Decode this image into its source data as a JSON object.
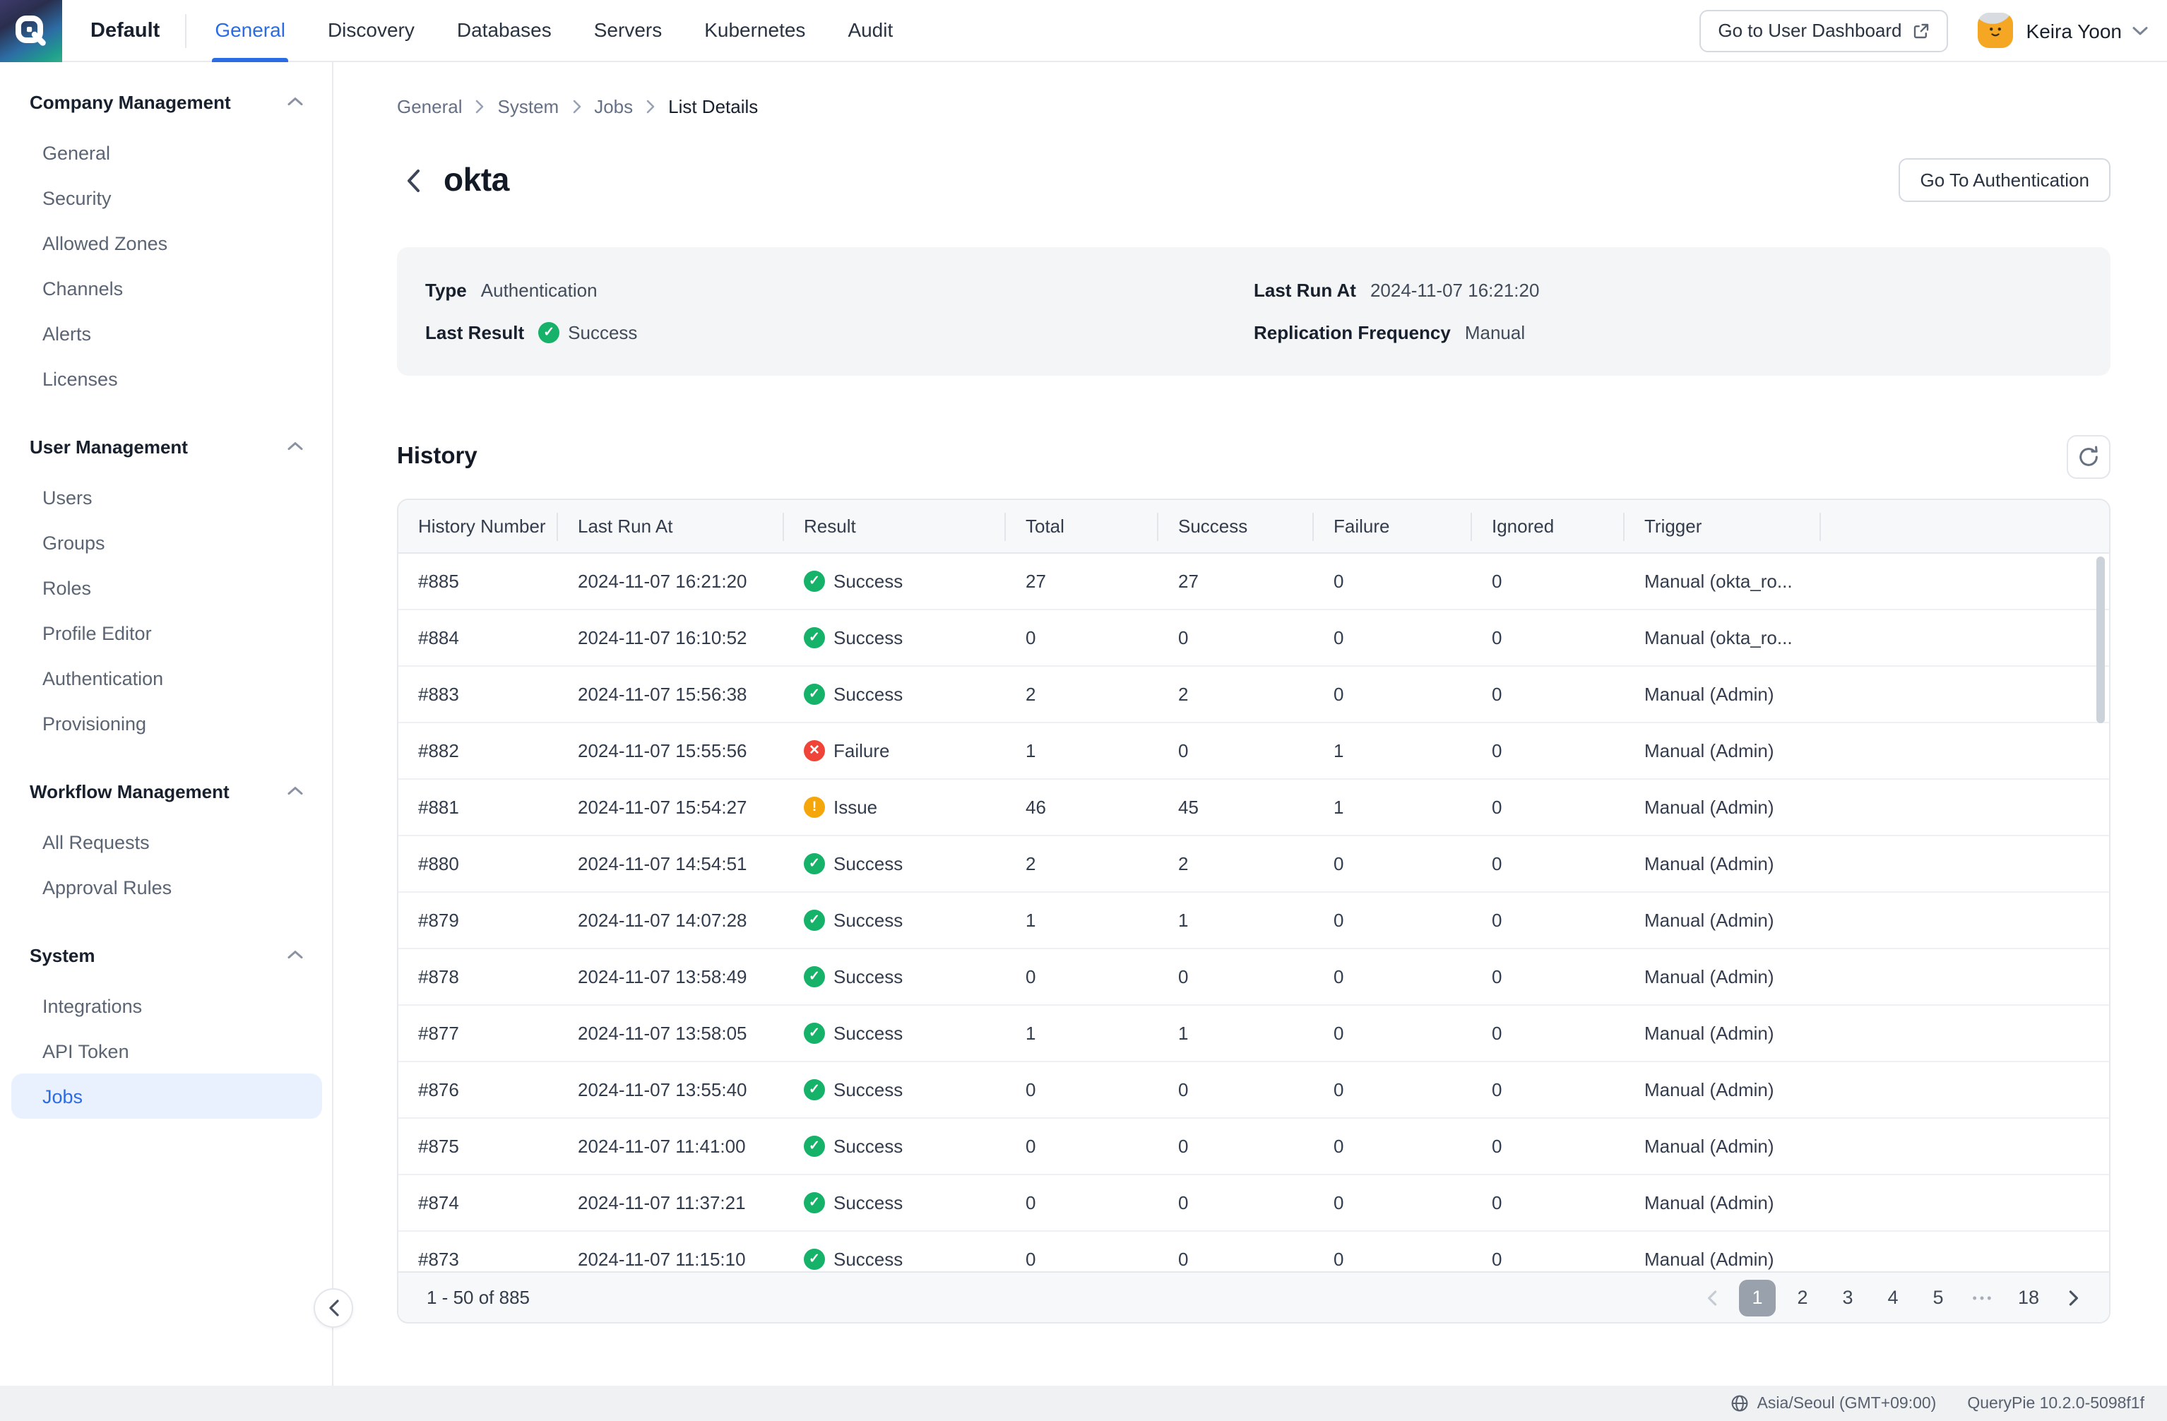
{
  "navbar": {
    "org": "Default",
    "tabs": [
      {
        "label": "General",
        "active": true
      },
      {
        "label": "Discovery",
        "active": false
      },
      {
        "label": "Databases",
        "active": false
      },
      {
        "label": "Servers",
        "active": false
      },
      {
        "label": "Kubernetes",
        "active": false
      },
      {
        "label": "Audit",
        "active": false
      }
    ],
    "dashboard_button": "Go to User Dashboard",
    "user_name": "Keira Yoon"
  },
  "sidebar": {
    "sections": [
      {
        "title": "Company Management",
        "items": [
          {
            "label": "General"
          },
          {
            "label": "Security"
          },
          {
            "label": "Allowed Zones"
          },
          {
            "label": "Channels"
          },
          {
            "label": "Alerts"
          },
          {
            "label": "Licenses"
          }
        ]
      },
      {
        "title": "User Management",
        "items": [
          {
            "label": "Users"
          },
          {
            "label": "Groups"
          },
          {
            "label": "Roles"
          },
          {
            "label": "Profile Editor"
          },
          {
            "label": "Authentication"
          },
          {
            "label": "Provisioning"
          }
        ]
      },
      {
        "title": "Workflow Management",
        "items": [
          {
            "label": "All Requests"
          },
          {
            "label": "Approval Rules"
          }
        ]
      },
      {
        "title": "System",
        "items": [
          {
            "label": "Integrations"
          },
          {
            "label": "API Token"
          },
          {
            "label": "Jobs",
            "active": true
          }
        ]
      }
    ]
  },
  "breadcrumb": [
    "General",
    "System",
    "Jobs",
    "List Details"
  ],
  "page": {
    "title": "okta",
    "action_button": "Go To Authentication"
  },
  "details": {
    "type_label": "Type",
    "type_value": "Authentication",
    "last_result_label": "Last Result",
    "last_result_value": "Success",
    "last_result_status": "success",
    "last_run_label": "Last Run At",
    "last_run_value": "2024-11-07 16:21:20",
    "replication_label": "Replication Frequency",
    "replication_value": "Manual"
  },
  "history": {
    "title": "History",
    "columns": [
      "History Number",
      "Last Run At",
      "Result",
      "Total",
      "Success",
      "Failure",
      "Ignored",
      "Trigger"
    ],
    "rows": [
      {
        "number": "#885",
        "last_run": "2024-11-07 16:21:20",
        "result": "Success",
        "status": "success",
        "total": "27",
        "success": "27",
        "failure": "0",
        "ignored": "0",
        "trigger": "Manual (okta_ro..."
      },
      {
        "number": "#884",
        "last_run": "2024-11-07 16:10:52",
        "result": "Success",
        "status": "success",
        "total": "0",
        "success": "0",
        "failure": "0",
        "ignored": "0",
        "trigger": "Manual (okta_ro..."
      },
      {
        "number": "#883",
        "last_run": "2024-11-07 15:56:38",
        "result": "Success",
        "status": "success",
        "total": "2",
        "success": "2",
        "failure": "0",
        "ignored": "0",
        "trigger": "Manual (Admin)"
      },
      {
        "number": "#882",
        "last_run": "2024-11-07 15:55:56",
        "result": "Failure",
        "status": "failure",
        "total": "1",
        "success": "0",
        "failure": "1",
        "ignored": "0",
        "trigger": "Manual (Admin)"
      },
      {
        "number": "#881",
        "last_run": "2024-11-07 15:54:27",
        "result": "Issue",
        "status": "issue",
        "total": "46",
        "success": "45",
        "failure": "1",
        "ignored": "0",
        "trigger": "Manual (Admin)"
      },
      {
        "number": "#880",
        "last_run": "2024-11-07 14:54:51",
        "result": "Success",
        "status": "success",
        "total": "2",
        "success": "2",
        "failure": "0",
        "ignored": "0",
        "trigger": "Manual (Admin)"
      },
      {
        "number": "#879",
        "last_run": "2024-11-07 14:07:28",
        "result": "Success",
        "status": "success",
        "total": "1",
        "success": "1",
        "failure": "0",
        "ignored": "0",
        "trigger": "Manual (Admin)"
      },
      {
        "number": "#878",
        "last_run": "2024-11-07 13:58:49",
        "result": "Success",
        "status": "success",
        "total": "0",
        "success": "0",
        "failure": "0",
        "ignored": "0",
        "trigger": "Manual (Admin)"
      },
      {
        "number": "#877",
        "last_run": "2024-11-07 13:58:05",
        "result": "Success",
        "status": "success",
        "total": "1",
        "success": "1",
        "failure": "0",
        "ignored": "0",
        "trigger": "Manual (Admin)"
      },
      {
        "number": "#876",
        "last_run": "2024-11-07 13:55:40",
        "result": "Success",
        "status": "success",
        "total": "0",
        "success": "0",
        "failure": "0",
        "ignored": "0",
        "trigger": "Manual (Admin)"
      },
      {
        "number": "#875",
        "last_run": "2024-11-07 11:41:00",
        "result": "Success",
        "status": "success",
        "total": "0",
        "success": "0",
        "failure": "0",
        "ignored": "0",
        "trigger": "Manual (Admin)"
      },
      {
        "number": "#874",
        "last_run": "2024-11-07 11:37:21",
        "result": "Success",
        "status": "success",
        "total": "0",
        "success": "0",
        "failure": "0",
        "ignored": "0",
        "trigger": "Manual (Admin)"
      },
      {
        "number": "#873",
        "last_run": "2024-11-07 11:15:10",
        "result": "Success",
        "status": "success",
        "total": "0",
        "success": "0",
        "failure": "0",
        "ignored": "0",
        "trigger": "Manual (Admin)"
      }
    ]
  },
  "pagination": {
    "range": "1 - 50 of 885",
    "pages": [
      "1",
      "2",
      "3",
      "4",
      "5",
      "•••",
      "18"
    ],
    "active_page": "1"
  },
  "footer": {
    "timezone": "Asia/Seoul (GMT+09:00)",
    "version": "QueryPie 10.2.0-5098f1f"
  },
  "colors": {
    "accent": "#2b6be4",
    "success": "#17b26a",
    "failure": "#f04438",
    "issue": "#f5a60a",
    "active_page_bg": "#99a1ad"
  }
}
